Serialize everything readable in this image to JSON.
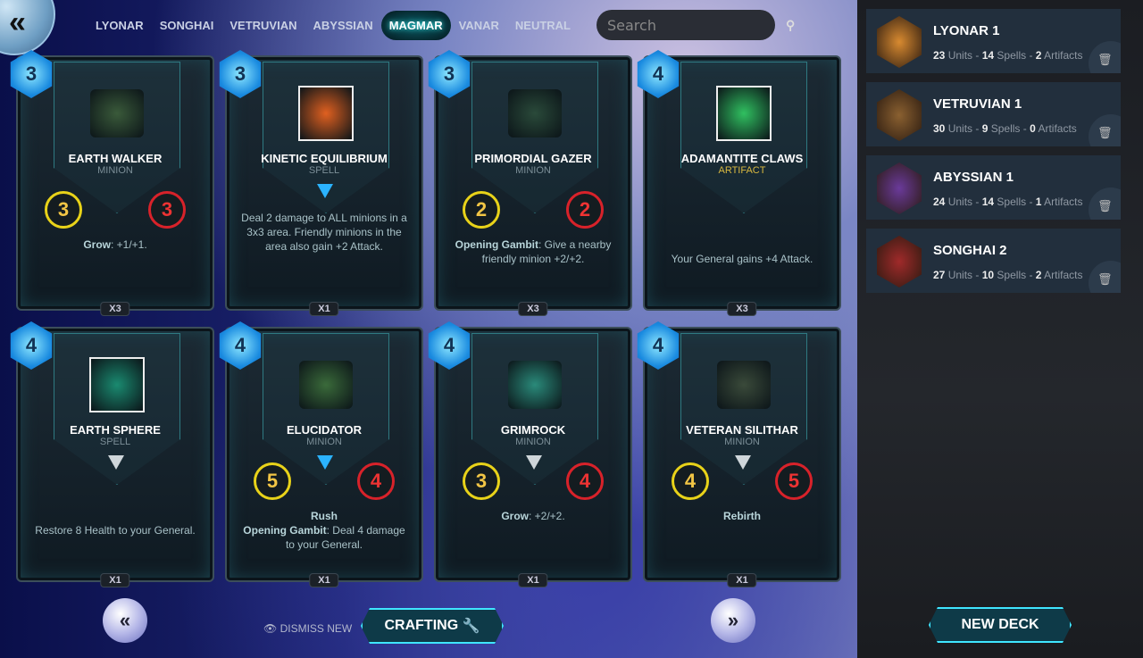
{
  "nav": {
    "back_icon": "double-chevron-left",
    "factions": [
      "LYONAR",
      "SONGHAI",
      "VETRUVIAN",
      "ABYSSIAN",
      "MAGMAR",
      "VANAR",
      "NEUTRAL"
    ],
    "active": "MAGMAR",
    "search_placeholder": "Search",
    "search_value": ""
  },
  "cards": [
    {
      "cost": "3",
      "name": "EARTH WALKER",
      "type": "MINION",
      "attack": "3",
      "health": "3",
      "keyword": "Grow",
      "text": ": +1/+1.",
      "count": "X3",
      "rarity": "none",
      "art_color": "#3a5a3a"
    },
    {
      "cost": "3",
      "name": "KINETIC EQUILIBRIUM",
      "type": "SPELL",
      "keyword": "",
      "text": "Deal 2 damage to ALL minions in a 3x3 area. Friendly minions in the area also gain +2 Attack.",
      "count": "X1",
      "rarity": "rare",
      "art_color": "#e06020"
    },
    {
      "cost": "3",
      "name": "PRIMORDIAL GAZER",
      "type": "MINION",
      "attack": "2",
      "health": "2",
      "keyword": "Opening Gambit",
      "text": ": Give a nearby friendly minion +2/+2.",
      "count": "X3",
      "rarity": "none",
      "art_color": "#2a4a3a"
    },
    {
      "cost": "4",
      "name": "ADAMANTITE CLAWS",
      "type": "ARTIFACT",
      "keyword": "",
      "text": "Your General gains +4 Attack.",
      "count": "X3",
      "rarity": "none",
      "art_color": "#30c060"
    },
    {
      "cost": "4",
      "name": "EARTH SPHERE",
      "type": "SPELL",
      "keyword": "",
      "text": "Restore 8 Health to your General.",
      "count": "X1",
      "rarity": "common",
      "art_color": "#1a8a70"
    },
    {
      "cost": "4",
      "name": "ELUCIDATOR",
      "type": "MINION",
      "attack": "5",
      "health": "4",
      "keyword": "Rush",
      "keyword2": "Opening Gambit",
      "text": ": Deal 4 damage to your General.",
      "count": "X1",
      "rarity": "rare",
      "art_color": "#3a6a3a"
    },
    {
      "cost": "4",
      "name": "GRIMROCK",
      "type": "MINION",
      "attack": "3",
      "health": "4",
      "keyword": "Grow",
      "text": ": +2/+2.",
      "count": "X1",
      "rarity": "common",
      "art_color": "#2a8a7a"
    },
    {
      "cost": "4",
      "name": "VETERAN SILITHAR",
      "type": "MINION",
      "attack": "4",
      "health": "5",
      "keyword": "Rebirth",
      "text": "",
      "count": "X1",
      "rarity": "common",
      "art_color": "#3a4a3a"
    }
  ],
  "footer": {
    "prev_icon": "double-chevron-left",
    "next_icon": "double-chevron-right",
    "dismiss_new": "DISMISS NEW",
    "dismiss_icon": "eye-icon",
    "crafting": "CRAFTING",
    "crafting_icon": "wrench-icon"
  },
  "decks": [
    {
      "name": "LYONAR 1",
      "units": "23",
      "spells": "14",
      "artifacts": "2",
      "color": "#d88a30"
    },
    {
      "name": "VETRUVIAN 1",
      "units": "30",
      "spells": "9",
      "artifacts": "0",
      "color": "#8a6030"
    },
    {
      "name": "ABYSSIAN 1",
      "units": "24",
      "spells": "14",
      "artifacts": "1",
      "color": "#6a3a9a"
    },
    {
      "name": "SONGHAI 2",
      "units": "27",
      "spells": "10",
      "artifacts": "2",
      "color": "#a02a2a"
    }
  ],
  "labels": {
    "units": "Units",
    "spells": "Spells",
    "artifacts": "Artifacts",
    "sep": " - "
  },
  "new_deck": "NEW DECK"
}
